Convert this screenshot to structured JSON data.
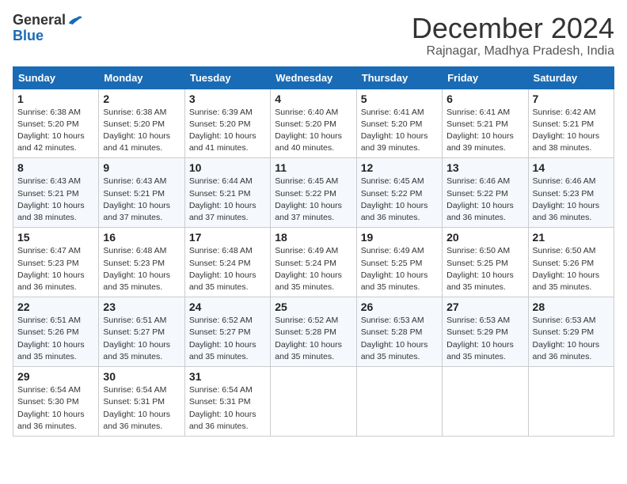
{
  "logo": {
    "text1": "General",
    "text2": "Blue"
  },
  "title": "December 2024",
  "subtitle": "Rajnagar, Madhya Pradesh, India",
  "weekdays": [
    "Sunday",
    "Monday",
    "Tuesday",
    "Wednesday",
    "Thursday",
    "Friday",
    "Saturday"
  ],
  "weeks": [
    [
      {
        "day": "1",
        "sunrise": "6:38 AM",
        "sunset": "5:20 PM",
        "daylight": "10 hours and 42 minutes."
      },
      {
        "day": "2",
        "sunrise": "6:38 AM",
        "sunset": "5:20 PM",
        "daylight": "10 hours and 41 minutes."
      },
      {
        "day": "3",
        "sunrise": "6:39 AM",
        "sunset": "5:20 PM",
        "daylight": "10 hours and 41 minutes."
      },
      {
        "day": "4",
        "sunrise": "6:40 AM",
        "sunset": "5:20 PM",
        "daylight": "10 hours and 40 minutes."
      },
      {
        "day": "5",
        "sunrise": "6:41 AM",
        "sunset": "5:20 PM",
        "daylight": "10 hours and 39 minutes."
      },
      {
        "day": "6",
        "sunrise": "6:41 AM",
        "sunset": "5:21 PM",
        "daylight": "10 hours and 39 minutes."
      },
      {
        "day": "7",
        "sunrise": "6:42 AM",
        "sunset": "5:21 PM",
        "daylight": "10 hours and 38 minutes."
      }
    ],
    [
      {
        "day": "8",
        "sunrise": "6:43 AM",
        "sunset": "5:21 PM",
        "daylight": "10 hours and 38 minutes."
      },
      {
        "day": "9",
        "sunrise": "6:43 AM",
        "sunset": "5:21 PM",
        "daylight": "10 hours and 37 minutes."
      },
      {
        "day": "10",
        "sunrise": "6:44 AM",
        "sunset": "5:21 PM",
        "daylight": "10 hours and 37 minutes."
      },
      {
        "day": "11",
        "sunrise": "6:45 AM",
        "sunset": "5:22 PM",
        "daylight": "10 hours and 37 minutes."
      },
      {
        "day": "12",
        "sunrise": "6:45 AM",
        "sunset": "5:22 PM",
        "daylight": "10 hours and 36 minutes."
      },
      {
        "day": "13",
        "sunrise": "6:46 AM",
        "sunset": "5:22 PM",
        "daylight": "10 hours and 36 minutes."
      },
      {
        "day": "14",
        "sunrise": "6:46 AM",
        "sunset": "5:23 PM",
        "daylight": "10 hours and 36 minutes."
      }
    ],
    [
      {
        "day": "15",
        "sunrise": "6:47 AM",
        "sunset": "5:23 PM",
        "daylight": "10 hours and 36 minutes."
      },
      {
        "day": "16",
        "sunrise": "6:48 AM",
        "sunset": "5:23 PM",
        "daylight": "10 hours and 35 minutes."
      },
      {
        "day": "17",
        "sunrise": "6:48 AM",
        "sunset": "5:24 PM",
        "daylight": "10 hours and 35 minutes."
      },
      {
        "day": "18",
        "sunrise": "6:49 AM",
        "sunset": "5:24 PM",
        "daylight": "10 hours and 35 minutes."
      },
      {
        "day": "19",
        "sunrise": "6:49 AM",
        "sunset": "5:25 PM",
        "daylight": "10 hours and 35 minutes."
      },
      {
        "day": "20",
        "sunrise": "6:50 AM",
        "sunset": "5:25 PM",
        "daylight": "10 hours and 35 minutes."
      },
      {
        "day": "21",
        "sunrise": "6:50 AM",
        "sunset": "5:26 PM",
        "daylight": "10 hours and 35 minutes."
      }
    ],
    [
      {
        "day": "22",
        "sunrise": "6:51 AM",
        "sunset": "5:26 PM",
        "daylight": "10 hours and 35 minutes."
      },
      {
        "day": "23",
        "sunrise": "6:51 AM",
        "sunset": "5:27 PM",
        "daylight": "10 hours and 35 minutes."
      },
      {
        "day": "24",
        "sunrise": "6:52 AM",
        "sunset": "5:27 PM",
        "daylight": "10 hours and 35 minutes."
      },
      {
        "day": "25",
        "sunrise": "6:52 AM",
        "sunset": "5:28 PM",
        "daylight": "10 hours and 35 minutes."
      },
      {
        "day": "26",
        "sunrise": "6:53 AM",
        "sunset": "5:28 PM",
        "daylight": "10 hours and 35 minutes."
      },
      {
        "day": "27",
        "sunrise": "6:53 AM",
        "sunset": "5:29 PM",
        "daylight": "10 hours and 35 minutes."
      },
      {
        "day": "28",
        "sunrise": "6:53 AM",
        "sunset": "5:29 PM",
        "daylight": "10 hours and 36 minutes."
      }
    ],
    [
      {
        "day": "29",
        "sunrise": "6:54 AM",
        "sunset": "5:30 PM",
        "daylight": "10 hours and 36 minutes."
      },
      {
        "day": "30",
        "sunrise": "6:54 AM",
        "sunset": "5:31 PM",
        "daylight": "10 hours and 36 minutes."
      },
      {
        "day": "31",
        "sunrise": "6:54 AM",
        "sunset": "5:31 PM",
        "daylight": "10 hours and 36 minutes."
      },
      null,
      null,
      null,
      null
    ]
  ]
}
